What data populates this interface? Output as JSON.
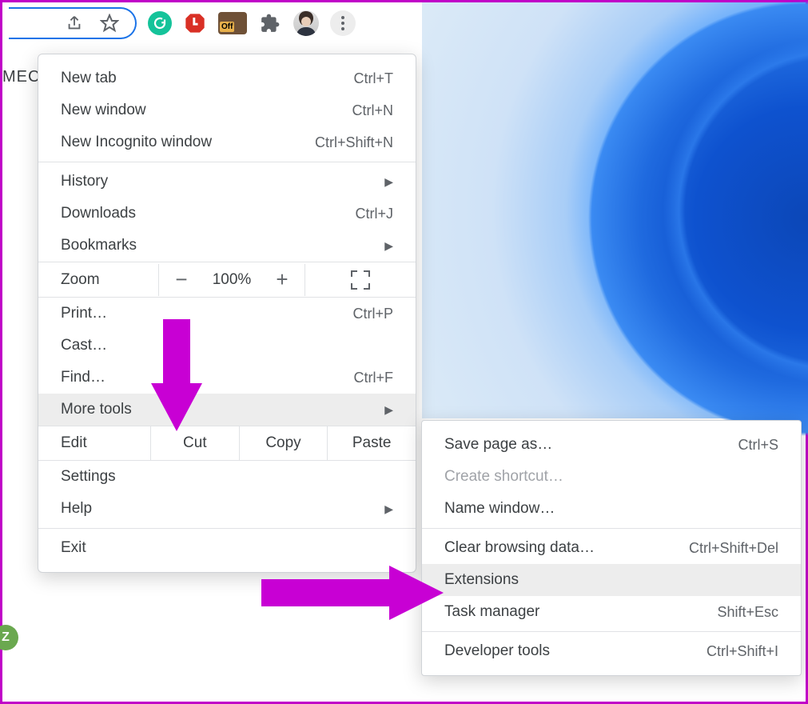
{
  "pageSnippet": "MEC",
  "zBadge": "Z",
  "toolbar": {
    "gtmBadge": "Off"
  },
  "menu": {
    "newTab": {
      "label": "New tab",
      "shortcut": "Ctrl+T"
    },
    "newWindow": {
      "label": "New window",
      "shortcut": "Ctrl+N"
    },
    "newIncognito": {
      "label": "New Incognito window",
      "shortcut": "Ctrl+Shift+N"
    },
    "history": {
      "label": "History"
    },
    "downloads": {
      "label": "Downloads",
      "shortcut": "Ctrl+J"
    },
    "bookmarks": {
      "label": "Bookmarks"
    },
    "zoom": {
      "label": "Zoom",
      "minus": "−",
      "value": "100%",
      "plus": "+"
    },
    "print": {
      "label": "Print…",
      "shortcut": "Ctrl+P"
    },
    "cast": {
      "label": "Cast…"
    },
    "find": {
      "label": "Find…",
      "shortcut": "Ctrl+F"
    },
    "moreTools": {
      "label": "More tools"
    },
    "edit": {
      "label": "Edit",
      "cut": "Cut",
      "copy": "Copy",
      "paste": "Paste"
    },
    "settings": {
      "label": "Settings"
    },
    "help": {
      "label": "Help"
    },
    "exit": {
      "label": "Exit"
    }
  },
  "submenu": {
    "savePage": {
      "label": "Save page as…",
      "shortcut": "Ctrl+S"
    },
    "createShortcut": {
      "label": "Create shortcut…"
    },
    "nameWindow": {
      "label": "Name window…"
    },
    "clearData": {
      "label": "Clear browsing data…",
      "shortcut": "Ctrl+Shift+Del"
    },
    "extensions": {
      "label": "Extensions"
    },
    "taskManager": {
      "label": "Task manager",
      "shortcut": "Shift+Esc"
    },
    "devTools": {
      "label": "Developer tools",
      "shortcut": "Ctrl+Shift+I"
    }
  },
  "arrowGlyph": "▶"
}
